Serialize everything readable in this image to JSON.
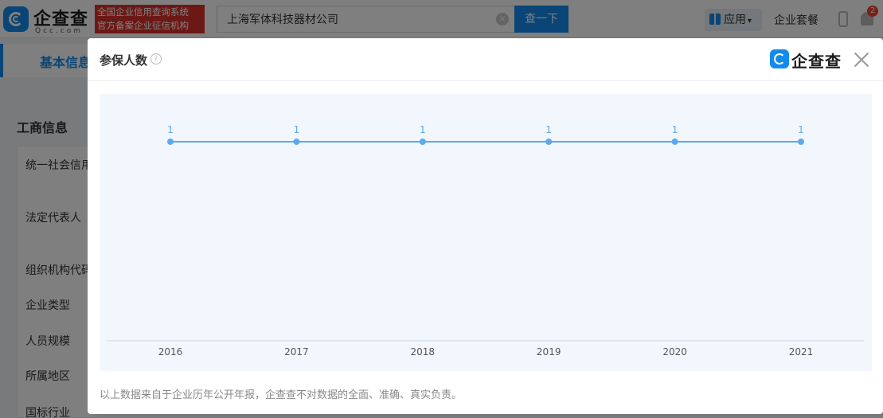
{
  "header": {
    "logo_text": "企查查",
    "logo_subtext": "Qcc.com",
    "slogan_line1": "全国企业信用查询系统",
    "slogan_line2": "官方备案企业征信机构",
    "search": {
      "value": "上海军体科技器材公司",
      "button_label": "查一下"
    },
    "apps_label": "应用",
    "suite_label": "企业套餐",
    "notification_count": "2"
  },
  "background": {
    "nav_tab": "基本信息",
    "section_title": "工商信息",
    "table_labels": [
      "统一社会信用",
      "法定代表人",
      "组织机构代码",
      "企业类型",
      "人员规模",
      "所属地区",
      "国标行业"
    ]
  },
  "modal": {
    "title": "参保人数",
    "logo_text": "企查查",
    "footnote": "以上数据来自于企业历年公开年报，企查查不对数据的全面、准确、真实负责。"
  },
  "chart_data": {
    "type": "line",
    "categories": [
      "2016",
      "2017",
      "2018",
      "2019",
      "2020",
      "2021"
    ],
    "series": [
      {
        "values": [
          1,
          1,
          1,
          1,
          1,
          1
        ]
      }
    ],
    "data_labels": true,
    "color": "#5aaaf0",
    "background": "#f2f7fd",
    "grid": false
  }
}
